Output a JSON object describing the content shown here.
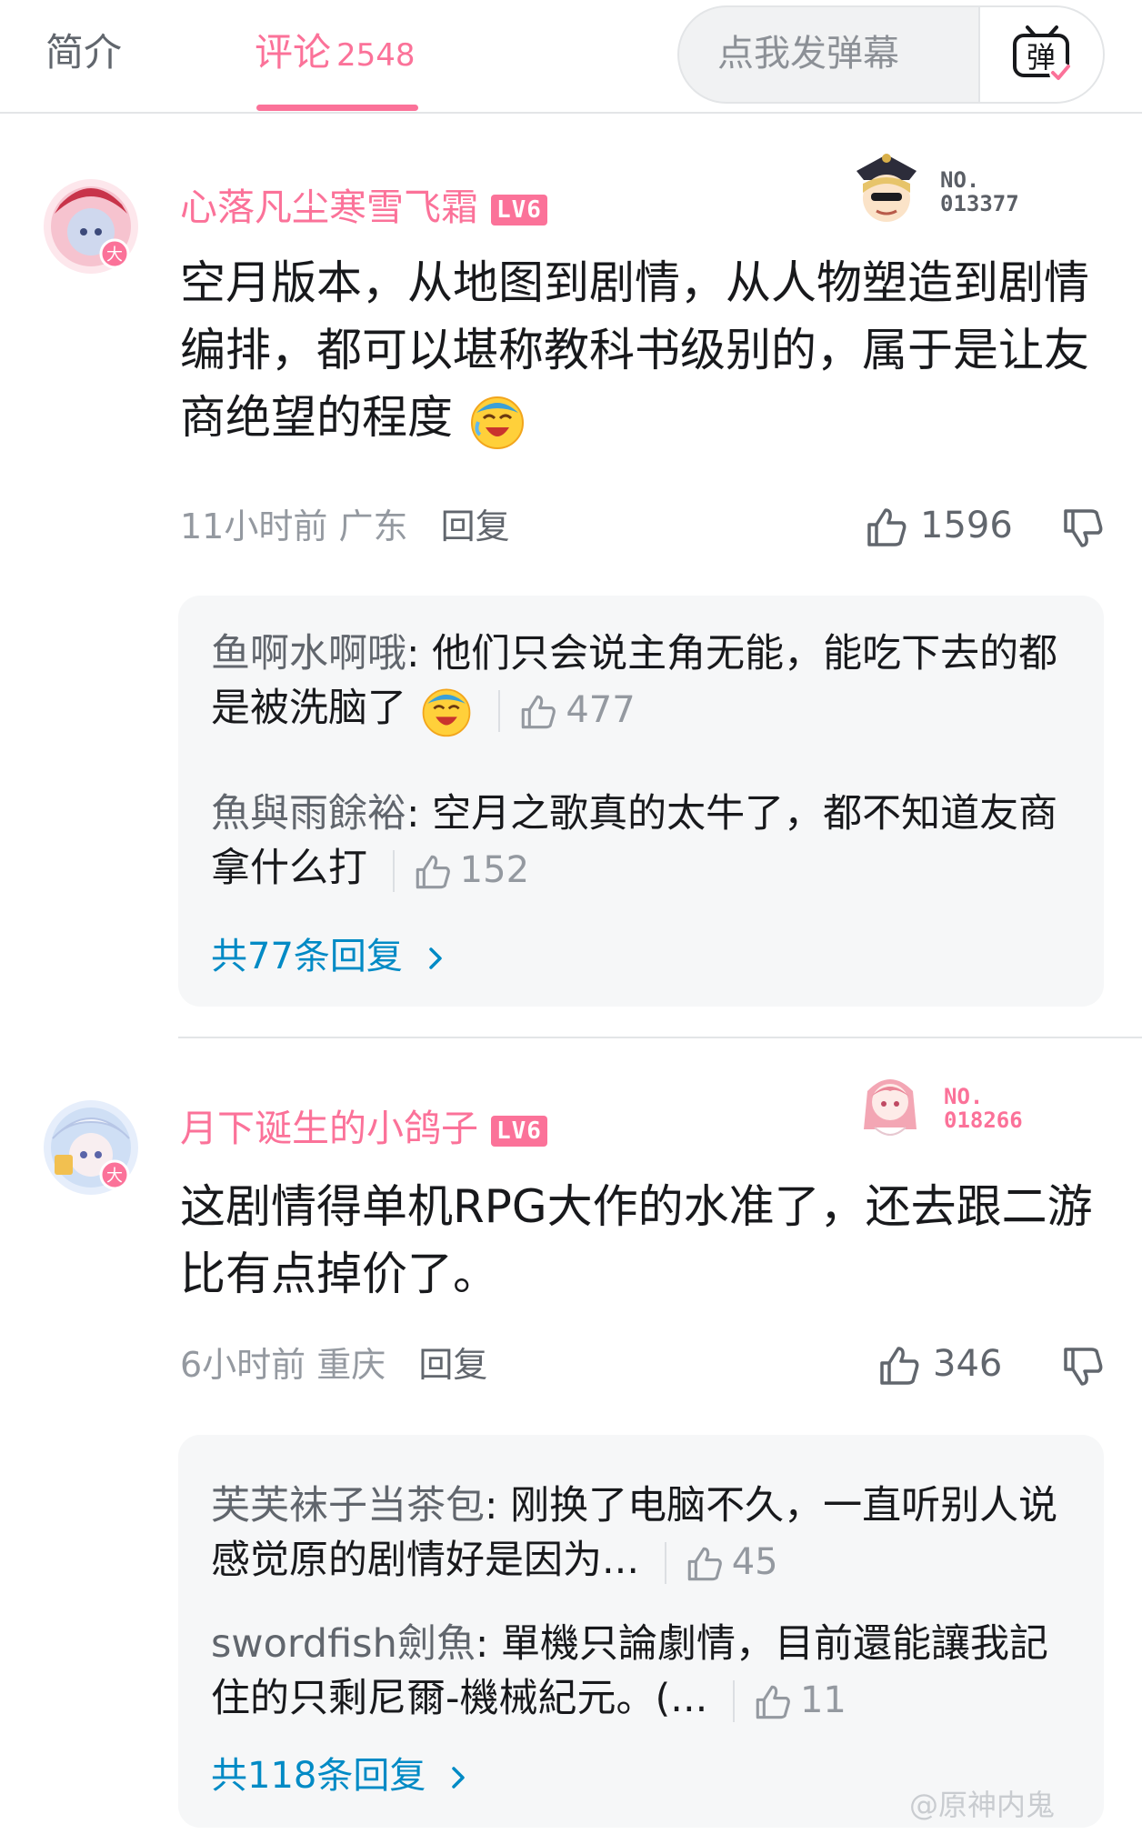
{
  "tabs": {
    "intro": "简介",
    "comments": "评论",
    "comments_count": "2548"
  },
  "danmaku": {
    "placeholder": "点我发弹幕",
    "button_glyph": "弹"
  },
  "comments": [
    {
      "username": "心落凡尘寒雪飞霜",
      "level": "LV6",
      "fan_no_label": "NO.",
      "fan_no": "013377",
      "avatar_badge": "大",
      "content": "空月版本，从地图到剧情，从人物塑造到剧情编排，都可以堪称教科书级别的，属于是让友商绝望的程度",
      "time": "11小时前",
      "location": "广东",
      "reply_label": "回复",
      "likes": "1596",
      "replies": [
        {
          "name": "鱼啊水啊哦",
          "text": "他们只会说主角无能，能吃下去的都是被洗脑了",
          "likes": "477"
        },
        {
          "name": "魚與雨餘裕",
          "text": "空月之歌真的太牛了，都不知道友商拿什么打",
          "likes": "152"
        }
      ],
      "more_replies": "共77条回复"
    },
    {
      "username": "月下诞生的小鸽子",
      "level": "LV6",
      "fan_no_label": "NO.",
      "fan_no": "018266",
      "avatar_badge": "大",
      "content": "这剧情得单机RPG大作的水准了，还去跟二游比有点掉价了。",
      "time": "6小时前",
      "location": "重庆",
      "reply_label": "回复",
      "likes": "346",
      "replies": [
        {
          "name": "芙芙袜子当茶包",
          "text": "刚换了电脑不久，一直听别人说感觉原的剧情好是因为...",
          "likes": "45"
        },
        {
          "name": "swordfish劍魚",
          "text": "單機只論劇情，目前還能讓我記住的只剩尼爾-機械紀元。(...",
          "likes": "11"
        }
      ],
      "more_replies": "共118条回复"
    }
  ],
  "colors": {
    "accent_pink": "#fb7299",
    "link_blue": "#008ac5",
    "meta_gray": "#9499a0",
    "reply_bg": "#f6f7f8"
  },
  "icons": [
    "thumb-up-icon",
    "thumb-down-icon",
    "chevron-right-icon",
    "danmaku-icon",
    "laughing-cry-emoji"
  ],
  "watermark": "@原神内鬼"
}
